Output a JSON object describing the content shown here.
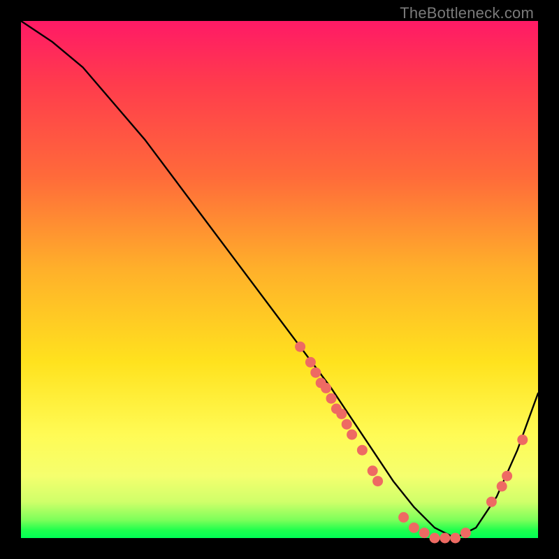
{
  "watermark": "TheBottleneck.com",
  "chart_data": {
    "type": "line",
    "title": "",
    "xlabel": "",
    "ylabel": "",
    "xlim": [
      0,
      100
    ],
    "ylim": [
      0,
      100
    ],
    "curve": {
      "name": "bottleneck-curve",
      "x": [
        0,
        6,
        12,
        18,
        24,
        30,
        36,
        42,
        48,
        54,
        60,
        64,
        68,
        72,
        76,
        80,
        84,
        88,
        92,
        96,
        100
      ],
      "y": [
        100,
        96,
        91,
        84,
        77,
        69,
        61,
        53,
        45,
        37,
        29,
        23,
        17,
        11,
        6,
        2,
        0,
        2,
        8,
        17,
        28
      ]
    },
    "data_points": [
      {
        "x": 54,
        "y": 37
      },
      {
        "x": 56,
        "y": 34
      },
      {
        "x": 57,
        "y": 32
      },
      {
        "x": 58,
        "y": 30
      },
      {
        "x": 59,
        "y": 29
      },
      {
        "x": 60,
        "y": 27
      },
      {
        "x": 61,
        "y": 25
      },
      {
        "x": 62,
        "y": 24
      },
      {
        "x": 63,
        "y": 22
      },
      {
        "x": 64,
        "y": 20
      },
      {
        "x": 66,
        "y": 17
      },
      {
        "x": 68,
        "y": 13
      },
      {
        "x": 69,
        "y": 11
      },
      {
        "x": 74,
        "y": 4
      },
      {
        "x": 76,
        "y": 2
      },
      {
        "x": 78,
        "y": 1
      },
      {
        "x": 80,
        "y": 0
      },
      {
        "x": 82,
        "y": 0
      },
      {
        "x": 84,
        "y": 0
      },
      {
        "x": 86,
        "y": 1
      },
      {
        "x": 91,
        "y": 7
      },
      {
        "x": 93,
        "y": 10
      },
      {
        "x": 94,
        "y": 12
      },
      {
        "x": 97,
        "y": 19
      }
    ],
    "colors": {
      "curve": "#000000",
      "points": "#ee6a63"
    }
  }
}
